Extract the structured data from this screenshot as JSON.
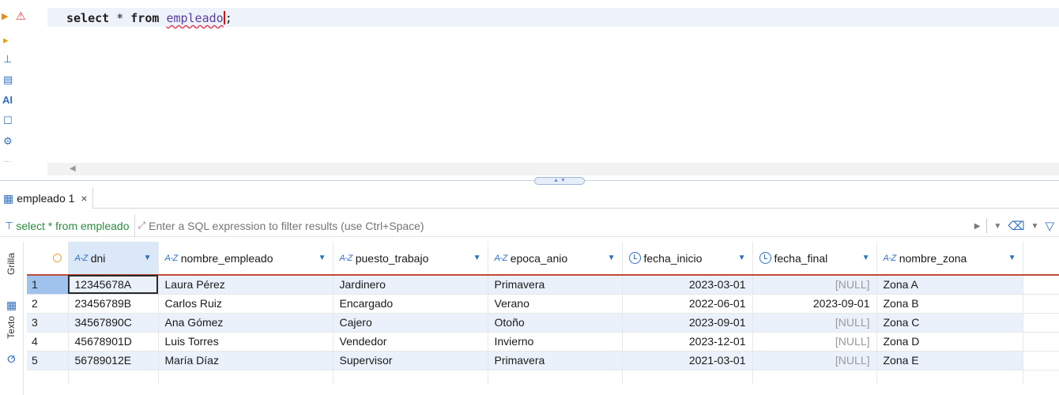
{
  "editor": {
    "keyword_select": "select",
    "star": "*",
    "keyword_from": "from",
    "table_name": "empleado",
    "terminator": ";"
  },
  "results_tab": {
    "label": "empleado 1",
    "close": "×"
  },
  "filter": {
    "query_label": "select * from empleado",
    "placeholder": "Enter a SQL expression to filter results (use Ctrl+Space)"
  },
  "side_tabs": {
    "grid": "Grilla",
    "text": "Texto"
  },
  "grid": {
    "type_prefix": "A-Z",
    "columns": [
      {
        "name": "dni",
        "type": "text"
      },
      {
        "name": "nombre_empleado",
        "type": "text"
      },
      {
        "name": "puesto_trabajo",
        "type": "text"
      },
      {
        "name": "epoca_anio",
        "type": "text"
      },
      {
        "name": "fecha_inicio",
        "type": "date"
      },
      {
        "name": "fecha_final",
        "type": "date"
      },
      {
        "name": "nombre_zona",
        "type": "text"
      }
    ],
    "rows": [
      {
        "n": "1",
        "dni": "12345678A",
        "nombre_empleado": "Laura Pérez",
        "puesto_trabajo": "Jardinero",
        "epoca_anio": "Primavera",
        "fecha_inicio": "2023-03-01",
        "fecha_final": "[NULL]",
        "nombre_zona": "Zona A"
      },
      {
        "n": "2",
        "dni": "23456789B",
        "nombre_empleado": "Carlos Ruiz",
        "puesto_trabajo": "Encargado",
        "epoca_anio": "Verano",
        "fecha_inicio": "2022-06-01",
        "fecha_final": "2023-09-01",
        "nombre_zona": "Zona B"
      },
      {
        "n": "3",
        "dni": "34567890C",
        "nombre_empleado": "Ana Gómez",
        "puesto_trabajo": "Cajero",
        "epoca_anio": "Otoño",
        "fecha_inicio": "2023-09-01",
        "fecha_final": "[NULL]",
        "nombre_zona": "Zona C"
      },
      {
        "n": "4",
        "dni": "45678901D",
        "nombre_empleado": "Luis Torres",
        "puesto_trabajo": "Vendedor",
        "epoca_anio": "Invierno",
        "fecha_inicio": "2023-12-01",
        "fecha_final": "[NULL]",
        "nombre_zona": "Zona D"
      },
      {
        "n": "5",
        "dni": "56789012E",
        "nombre_empleado": "María Díaz",
        "puesto_trabajo": "Supervisor",
        "epoca_anio": "Primavera",
        "fecha_inicio": "2021-03-01",
        "fecha_final": "[NULL]",
        "nombre_zona": "Zona E"
      }
    ]
  },
  "colors": {
    "header_underline": "#c24b3a",
    "row_stripe": "#eaf1fb",
    "active_row": "#9fc3ec",
    "accent": "#2f6fbf"
  },
  "icons": [
    "run-arrow-icon",
    "warning-icon",
    "execute-script-icon",
    "explain-icon",
    "ai-assist-icon",
    "outline-icon",
    "settings-icon",
    "table-icon",
    "filter-sql-icon",
    "expand-icon",
    "play-icon",
    "dropdown-icon",
    "eraser-icon",
    "funnel-icon",
    "clock-icon"
  ]
}
